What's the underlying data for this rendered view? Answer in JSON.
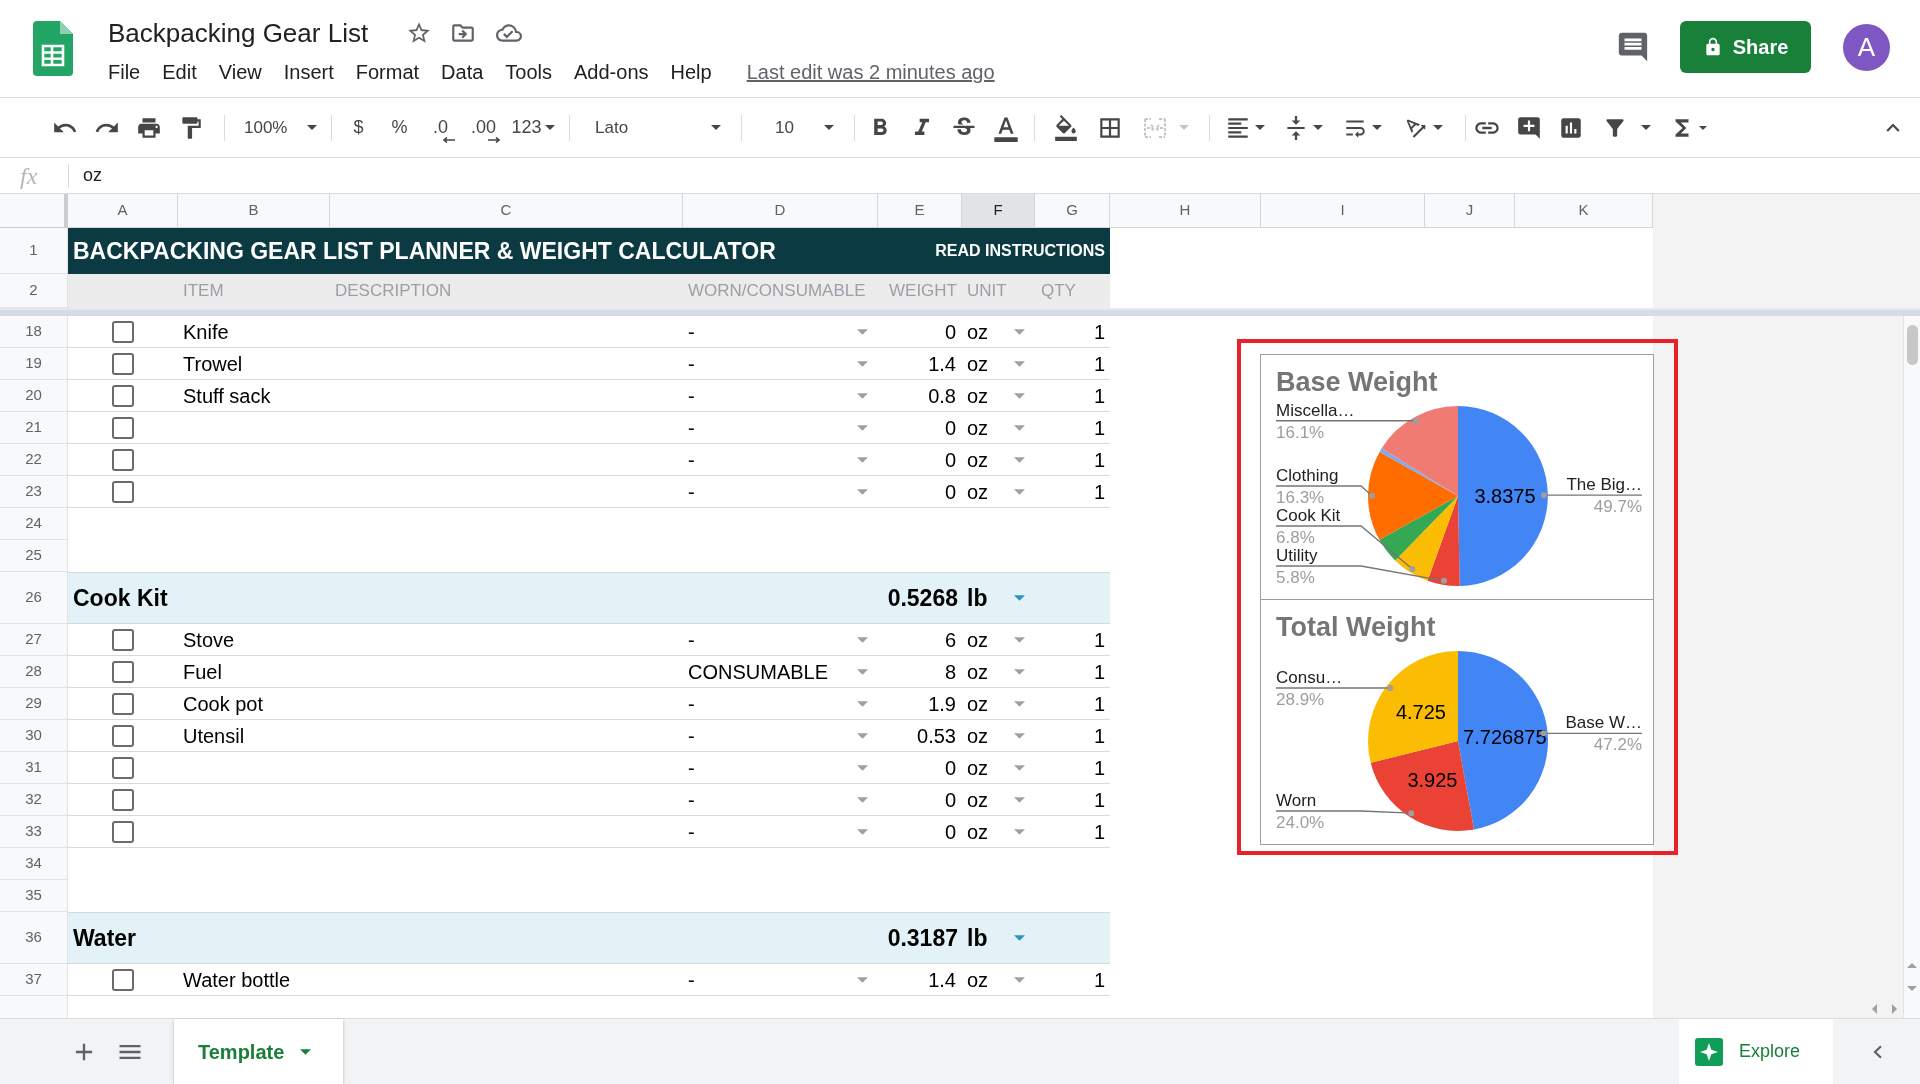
{
  "document": {
    "title": "Backpacking Gear List",
    "starred": false
  },
  "menu": [
    "File",
    "Edit",
    "View",
    "Insert",
    "Format",
    "Data",
    "Tools",
    "Add-ons",
    "Help"
  ],
  "last_edit": "Last edit was 2 minutes ago",
  "share_button": {
    "label": "Share"
  },
  "account": {
    "initial": "A"
  },
  "toolbar": {
    "zoom": "100%",
    "format_buttons": [
      {
        "label": "$",
        "kind": "plain"
      },
      {
        "label": "%",
        "kind": "plain"
      },
      {
        "label": ".0",
        "kind": "decrease"
      },
      {
        "label": ".00",
        "kind": "increase"
      }
    ],
    "number_format": "123",
    "font": "Lato",
    "font_size": "10",
    "merge_cells": {
      "disabled": true
    }
  },
  "formula_bar": {
    "label": "fx",
    "value": "oz"
  },
  "columns": [
    {
      "label": "A",
      "selected": false
    },
    {
      "label": "B",
      "selected": false
    },
    {
      "label": "C",
      "selected": false
    },
    {
      "label": "D",
      "selected": false
    },
    {
      "label": "E",
      "selected": false
    },
    {
      "label": "F",
      "selected": true
    },
    {
      "label": "G",
      "selected": false
    },
    {
      "label": "H",
      "selected": false
    },
    {
      "label": "I",
      "selected": false
    },
    {
      "label": "J",
      "selected": false
    },
    {
      "label": "K",
      "selected": false
    }
  ],
  "frozen_rows": [
    {
      "kind": "title",
      "number": "1",
      "title": "BACKPACKING GEAR LIST PLANNER & WEIGHT CALCULATOR",
      "link": "READ INSTRUCTIONS"
    },
    {
      "kind": "header",
      "number": "2",
      "item": "ITEM",
      "description": "DESCRIPTION",
      "type": "WORN/CONSUMABLE",
      "weight": "WEIGHT",
      "unit": "UNIT",
      "qty": "QTY"
    }
  ],
  "rows": [
    {
      "kind": "item",
      "number": "18",
      "checked": false,
      "item": "Knife",
      "type": "-",
      "weight": "0",
      "unit": "oz",
      "qty": "1"
    },
    {
      "kind": "item",
      "number": "19",
      "checked": false,
      "item": "Trowel",
      "type": "-",
      "weight": "1.4",
      "unit": "oz",
      "qty": "1"
    },
    {
      "kind": "item",
      "number": "20",
      "checked": false,
      "item": "Stuff sack",
      "type": "-",
      "weight": "0.8",
      "unit": "oz",
      "qty": "1"
    },
    {
      "kind": "item",
      "number": "21",
      "checked": false,
      "type": "-",
      "weight": "0",
      "unit": "oz",
      "qty": "1"
    },
    {
      "kind": "item",
      "number": "22",
      "checked": false,
      "type": "-",
      "weight": "0",
      "unit": "oz",
      "qty": "1"
    },
    {
      "kind": "item",
      "number": "23",
      "checked": false,
      "type": "-",
      "weight": "0",
      "unit": "oz",
      "qty": "1"
    },
    {
      "kind": "blank",
      "number": "24"
    },
    {
      "kind": "blank",
      "number": "25"
    },
    {
      "kind": "group",
      "number": "26",
      "name": "Cook Kit",
      "weight": "0.5268",
      "unit": "lb"
    },
    {
      "kind": "item",
      "number": "27",
      "checked": false,
      "item": "Stove",
      "type": "-",
      "weight": "6",
      "unit": "oz",
      "qty": "1"
    },
    {
      "kind": "item",
      "number": "28",
      "checked": false,
      "item": "Fuel",
      "type": "CONSUMABLE",
      "weight": "8",
      "unit": "oz",
      "qty": "1"
    },
    {
      "kind": "item",
      "number": "29",
      "checked": false,
      "item": "Cook pot",
      "type": "-",
      "weight": "1.9",
      "unit": "oz",
      "qty": "1"
    },
    {
      "kind": "item",
      "number": "30",
      "checked": false,
      "item": "Utensil",
      "type": "-",
      "weight": "0.53",
      "unit": "oz",
      "qty": "1"
    },
    {
      "kind": "item",
      "number": "31",
      "checked": false,
      "type": "-",
      "weight": "0",
      "unit": "oz",
      "qty": "1"
    },
    {
      "kind": "item",
      "number": "32",
      "checked": false,
      "type": "-",
      "weight": "0",
      "unit": "oz",
      "qty": "1"
    },
    {
      "kind": "item",
      "number": "33",
      "checked": false,
      "type": "-",
      "weight": "0",
      "unit": "oz",
      "qty": "1"
    },
    {
      "kind": "blank",
      "number": "34"
    },
    {
      "kind": "blank",
      "number": "35"
    },
    {
      "kind": "group",
      "number": "36",
      "name": "Water",
      "weight": "0.3187",
      "unit": "lb"
    },
    {
      "kind": "item",
      "number": "37",
      "checked": false,
      "item": "Water bottle",
      "type": "-",
      "weight": "1.4",
      "unit": "oz",
      "qty": "1"
    }
  ],
  "charts": [
    {
      "chart_data": {
        "type": "pie",
        "title": "Base Weight",
        "categories": [
          "The Big…",
          "Utility",
          "Cook Kit",
          null,
          "Clothing",
          null,
          "Miscella…"
        ],
        "values": [
          49.7,
          5.8,
          6.8,
          4.6,
          16.3,
          0.7,
          16.1
        ],
        "colors": [
          "#4285f4",
          "#ea4335",
          "#fbbc04",
          "#34a853",
          "#ff6d01",
          "#7baaf7",
          "#f07b72"
        ],
        "value_labels": [
          "49.7%",
          "5.8%",
          "6.8%",
          null,
          "16.3%",
          null,
          "16.1%"
        ],
        "annotations": [
          {
            "text": "3.8375"
          }
        ]
      }
    },
    {
      "chart_data": {
        "type": "pie",
        "title": "Total Weight",
        "categories": [
          "Base W…",
          "Worn",
          "Consu…"
        ],
        "values": [
          47.2,
          24.0,
          28.9
        ],
        "colors": [
          "#4285f4",
          "#ea4335",
          "#fbbc04"
        ],
        "value_labels": [
          "47.2%",
          "24.0%",
          "28.9%"
        ],
        "annotations": [
          {
            "text": "7.726875"
          },
          {
            "text": "3.925"
          },
          {
            "text": "4.725"
          }
        ]
      }
    }
  ],
  "chart_highlight": true,
  "sheet_tabs": [
    {
      "label": "Template",
      "selected": true
    }
  ],
  "explore_button": {
    "label": "Explore"
  }
}
